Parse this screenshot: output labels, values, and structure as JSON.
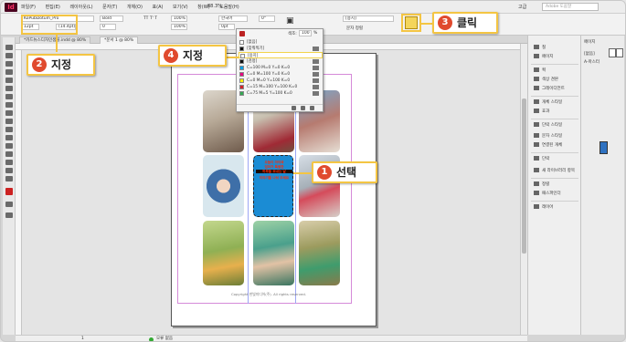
{
  "menubar": {
    "logo": "Id",
    "menus": [
      "파일(F)",
      "편집(E)",
      "레이아웃(L)",
      "문자(T)",
      "개체(O)",
      "표(A)",
      "보기(V)",
      "창(W)",
      "도움말(H)"
    ],
    "zoom": "88.3%",
    "workspace": "고급",
    "search_placeholder": "Adobe 도움말"
  },
  "control": {
    "font_name": "KoPubDotum_Pro",
    "font_style": "Bold",
    "size": "12pt",
    "leading": "(14.4pt)",
    "tracking": "0",
    "kerning": "0",
    "scale": "100%",
    "color_label": "[용지]",
    "baseline": "0pt",
    "angle": "0°",
    "lang": "한국어",
    "none_label": "[없음]",
    "grid_label": "문자 정렬"
  },
  "tabs": [
    "*카드뉴스디자인샘플.indd @ 80%",
    "*문서 1 @ 80%"
  ],
  "status": {
    "page": "1",
    "state": "오류 없음"
  },
  "swatches": {
    "tint_label": "색조:",
    "tint_value": "100",
    "tint_unit": "%",
    "rows": [
      {
        "name": "[없음]",
        "color": "#ffffff"
      },
      {
        "name": "[맞춰찍기]",
        "color": "#111111"
      },
      {
        "name": "[용지]",
        "color": "#ffffff"
      },
      {
        "name": "[검정]",
        "color": "#111111"
      },
      {
        "name": "C=100 M=0 Y=0 K=0",
        "color": "#00a0e6"
      },
      {
        "name": "C=0 M=100 Y=0 K=0",
        "color": "#e6007e"
      },
      {
        "name": "C=0 M=0 Y=100 K=0",
        "color": "#ffee00"
      },
      {
        "name": "C=15 M=100 Y=100 K=0",
        "color": "#d2232a"
      },
      {
        "name": "C=75 M=5 Y=100 K=0",
        "color": "#34a853"
      }
    ]
  },
  "card_text": [
    "오늘이 아이와",
    "엄마가 특별한",
    "하루를 보내는 날",
    "이야기를 나눠 주세요"
  ],
  "copyright": "Copyright 한빛미디어(주). All rights reserved.",
  "right_panel": [
    {
      "label": "칠",
      "icon": "fill-icon"
    },
    {
      "label": "페이지",
      "icon": "pages-icon"
    },
    {
      "label": "획",
      "icon": "stroke-icon"
    },
    {
      "label": "색상 견본",
      "icon": "swatches-icon"
    },
    {
      "label": "그레이디언트",
      "icon": "gradient-icon"
    },
    {
      "label": "개체 스타일",
      "icon": "object-style-icon"
    },
    {
      "label": "효과",
      "icon": "effects-icon"
    },
    {
      "label": "단락 스타일",
      "icon": "paragraph-style-icon"
    },
    {
      "label": "문자 스타일",
      "icon": "character-style-icon"
    },
    {
      "label": "연결된 개체",
      "icon": "links-icon"
    },
    {
      "label": "단락",
      "icon": "paragraph-icon"
    },
    {
      "label": "새 라이브러리 항목",
      "icon": "library-icon"
    },
    {
      "label": "정렬",
      "icon": "align-icon"
    },
    {
      "label": "패스파인더",
      "icon": "pathfinder-icon"
    },
    {
      "label": "레이어",
      "icon": "layers-icon"
    }
  ],
  "pages_panel": {
    "title": "페이지",
    "none": "[없음]",
    "master": "A-마스터"
  },
  "callouts": [
    {
      "num": "1",
      "text": "선택"
    },
    {
      "num": "2",
      "text": "지정"
    },
    {
      "num": "3",
      "text": "클릭"
    },
    {
      "num": "4",
      "text": "지정"
    }
  ]
}
